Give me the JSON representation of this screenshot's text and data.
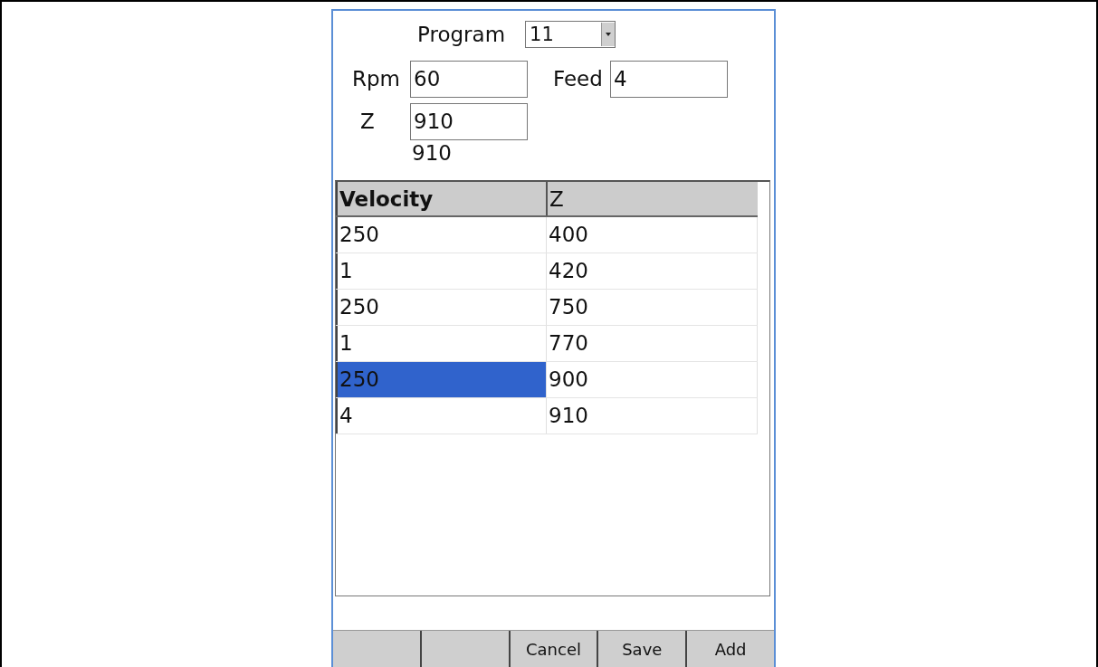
{
  "form": {
    "program": {
      "label": "Program",
      "value": "11"
    },
    "rpm": {
      "label": "Rpm",
      "value": "60"
    },
    "feed": {
      "label": "Feed",
      "value": "4"
    },
    "z": {
      "label": "Z",
      "value": "910",
      "reading": "910"
    }
  },
  "table": {
    "columns": [
      "Velocity",
      "Z"
    ],
    "rows": [
      {
        "cells": [
          {
            "text": "250",
            "selected": false
          },
          {
            "text": "400",
            "selected": false
          }
        ]
      },
      {
        "cells": [
          {
            "text": "1",
            "selected": false
          },
          {
            "text": "420",
            "selected": false
          }
        ]
      },
      {
        "cells": [
          {
            "text": "250",
            "selected": false
          },
          {
            "text": "750",
            "selected": false
          }
        ]
      },
      {
        "cells": [
          {
            "text": "1",
            "selected": false
          },
          {
            "text": "770",
            "selected": false
          }
        ]
      },
      {
        "cells": [
          {
            "text": "250",
            "selected": true
          },
          {
            "text": "900",
            "selected": false
          }
        ]
      },
      {
        "cells": [
          {
            "text": "4",
            "selected": false
          },
          {
            "text": "910",
            "selected": false
          }
        ]
      }
    ]
  },
  "buttons": [
    {
      "kind": "blank"
    },
    {
      "kind": "blank"
    },
    {
      "kind": "labeled",
      "label": "Cancel"
    },
    {
      "kind": "labeled",
      "label": "Save"
    },
    {
      "kind": "labeled",
      "label": "Add"
    }
  ]
}
